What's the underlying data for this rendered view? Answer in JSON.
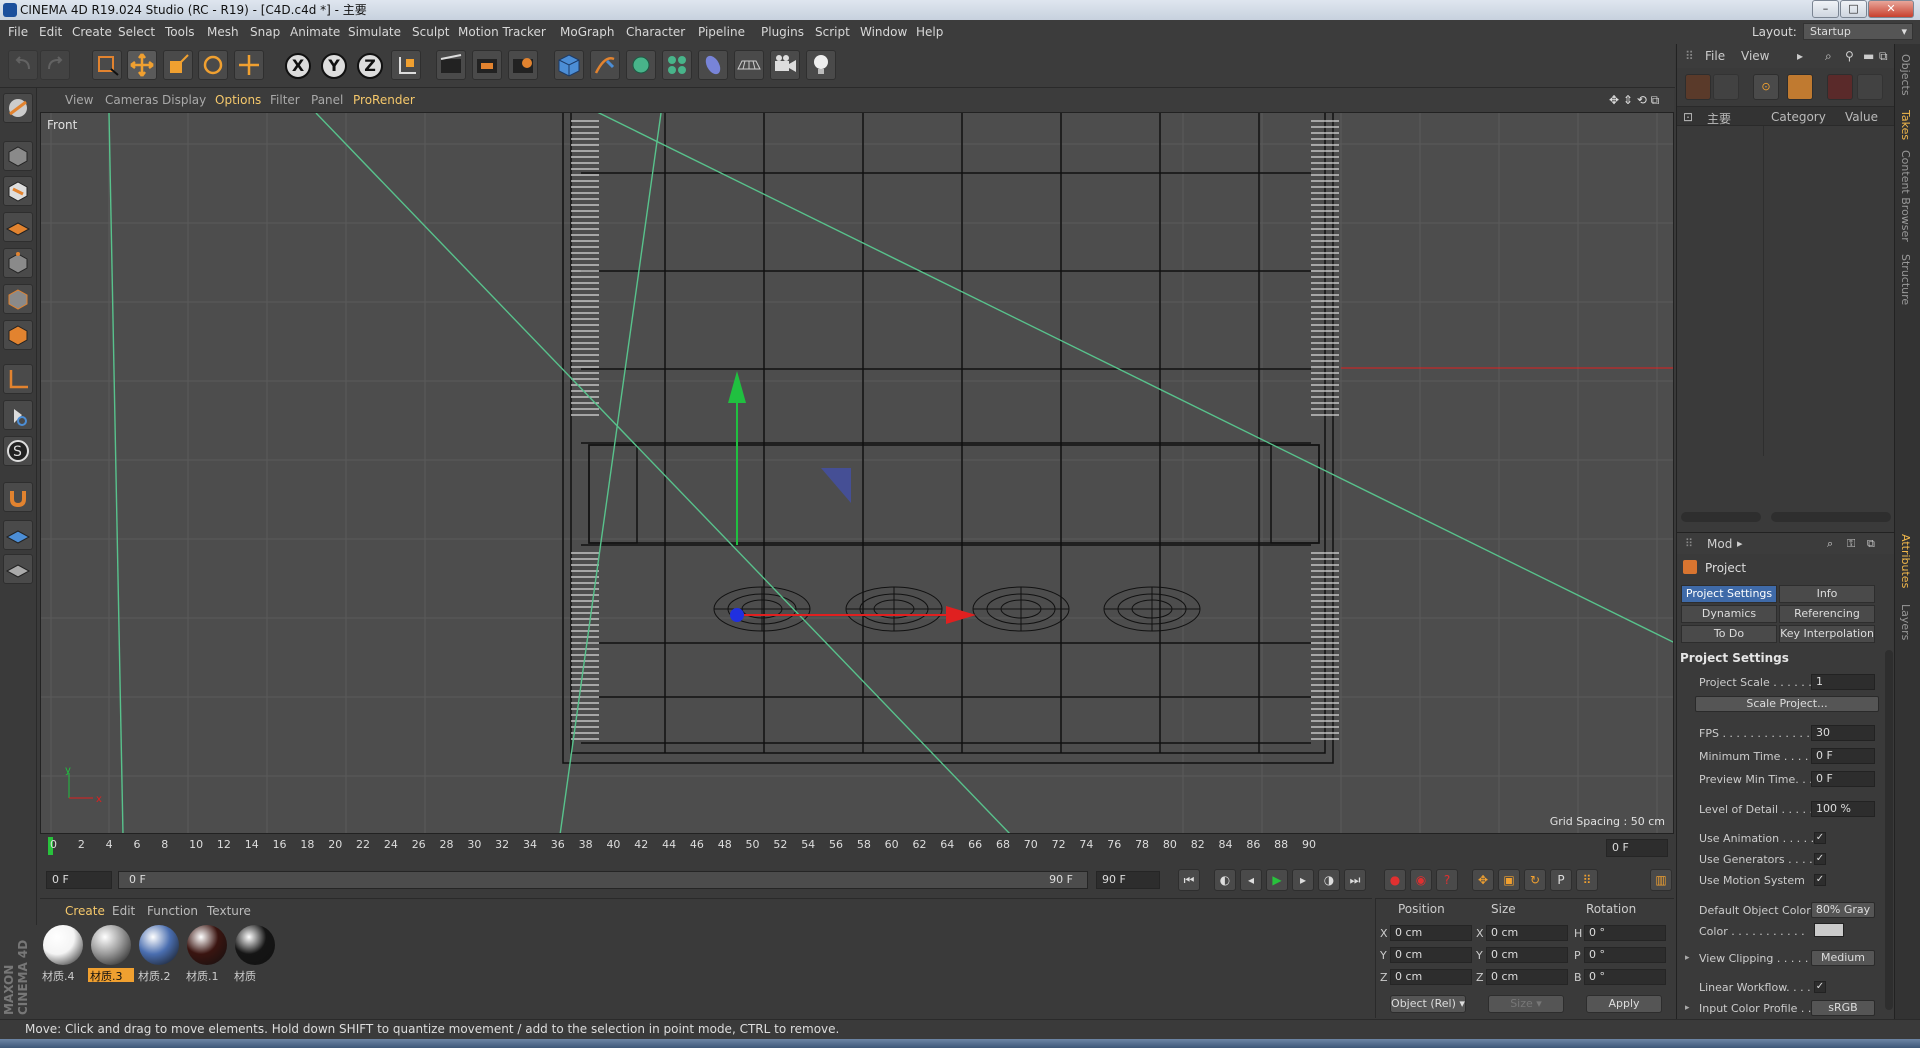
{
  "window": {
    "title": "CINEMA 4D R19.024 Studio (RC - R19) - [C4D.c4d *] - 主要"
  },
  "menu": [
    "File",
    "Edit",
    "Create",
    "Select",
    "Tools",
    "Mesh",
    "Snap",
    "Animate",
    "Simulate",
    "Sculpt",
    "Motion Tracker",
    "MoGraph",
    "Character",
    "Pipeline",
    "Plugins",
    "Script",
    "Window",
    "Help"
  ],
  "layout": {
    "label": "Layout:",
    "value": "Startup"
  },
  "viewport": {
    "menu": [
      "View",
      "Cameras",
      "Display",
      "Options",
      "Filter",
      "Panel",
      "ProRender"
    ],
    "active_menu": "Options",
    "label": "Front",
    "grid_spacing": "Grid Spacing : 50 cm"
  },
  "timeline": {
    "ticks": [
      "0",
      "2",
      "4",
      "6",
      "8",
      "10",
      "12",
      "14",
      "16",
      "18",
      "20",
      "22",
      "24",
      "26",
      "28",
      "30",
      "32",
      "34",
      "36",
      "38",
      "40",
      "42",
      "44",
      "46",
      "48",
      "50",
      "52",
      "54",
      "56",
      "58",
      "60",
      "62",
      "64",
      "66",
      "68",
      "70",
      "72",
      "74",
      "76",
      "78",
      "80",
      "82",
      "84",
      "86",
      "88",
      "90"
    ],
    "current_frame": "0 F"
  },
  "playbar": {
    "start": "0 F",
    "range_left": "0 F",
    "range_right": "90 F",
    "end": "90 F"
  },
  "material_manager": {
    "menu": [
      "Create",
      "Edit",
      "Function",
      "Texture"
    ],
    "materials": [
      {
        "name": "材质.4",
        "color": "#f4f4f4"
      },
      {
        "name": "材质.3",
        "color": "#9a9a9a"
      },
      {
        "name": "材质.2",
        "color": "#4a6eb0"
      },
      {
        "name": "材质.1",
        "color": "#3a1410"
      },
      {
        "name": "材质",
        "color": "#151515"
      }
    ]
  },
  "coordinates": {
    "headers": [
      "Position",
      "Size",
      "Rotation"
    ],
    "rows": [
      {
        "a": "X",
        "pos": "0 cm",
        "b": "X",
        "size": "0 cm",
        "c": "H",
        "rot": "0 °"
      },
      {
        "a": "Y",
        "pos": "0 cm",
        "b": "Y",
        "size": "0 cm",
        "c": "P",
        "rot": "0 °"
      },
      {
        "a": "Z",
        "pos": "0 cm",
        "b": "Z",
        "size": "0 cm",
        "c": "B",
        "rot": "0 °"
      }
    ],
    "mode": "Object (Rel)",
    "size_mode": "Size",
    "apply": "Apply"
  },
  "status": "Move: Click and drag to move elements. Hold down SHIFT to quantize movement / add to the selection in point mode, CTRL to remove.",
  "object_manager": {
    "menu": [
      "File",
      "View"
    ],
    "columns": [
      "主要",
      "Category",
      "Value"
    ]
  },
  "attributes": {
    "menu": "Mod",
    "title": "Project",
    "tabs": [
      "Project Settings",
      "Info",
      "Dynamics",
      "Referencing",
      "To Do",
      "Key Interpolation"
    ],
    "section": "Project Settings",
    "rows": [
      {
        "label": "Project Scale . . . . . . .",
        "value": "1"
      },
      {
        "label": "FPS . . . . . . . . . . . . . . .",
        "value": "30"
      },
      {
        "label": "Minimum Time . . . . .",
        "value": "0 F"
      },
      {
        "label": "Preview Min Time. . .",
        "value": "0 F"
      },
      {
        "label": "Level of Detail . . . . . .",
        "value": "100 %"
      },
      {
        "label": "Use Animation . . . . .",
        "value": "✓"
      },
      {
        "label": "Use Generators . . . . .",
        "value": "✓"
      },
      {
        "label": "Use Motion System",
        "value": "✓"
      },
      {
        "label": "Default Object Color",
        "value": "80% Gray"
      },
      {
        "label": "Color . . . . . . . . . . .",
        "value": ""
      },
      {
        "label": "View Clipping . . . . . .",
        "value": "Medium"
      },
      {
        "label": "Linear Workflow. . . .",
        "value": "✓"
      },
      {
        "label": "Input Color Profile . .",
        "value": "sRGB"
      }
    ],
    "scale_button": "Scale Project..."
  },
  "side_tabs": [
    "Objects",
    "Takes",
    "Content Browser",
    "Structure",
    "Attributes",
    "Layers"
  ],
  "branding": "MAXON CINEMA 4D",
  "colors": {
    "accent": "#f5c86b",
    "tab_active": "#3f6aa8",
    "viewport_bg": "#4d4d4d",
    "axis_x": "#e02020",
    "axis_y": "#20c040",
    "axis_z": "#2030e0"
  }
}
